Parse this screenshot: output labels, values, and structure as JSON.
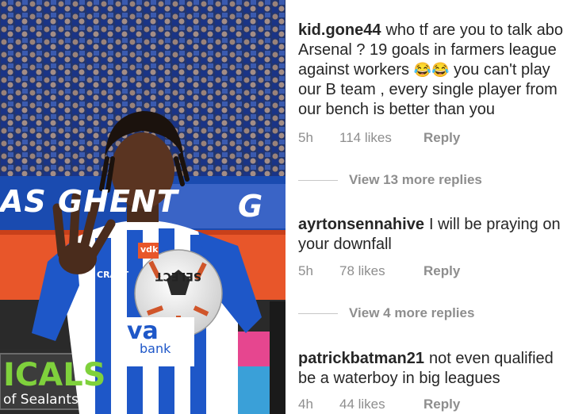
{
  "photo": {
    "banner_left_text": "AS GHENT",
    "banner_right_text": "G",
    "sign_text_main": "ICALS",
    "sign_text_sub": "of Sealants",
    "shirt_sponsor_line1": "va",
    "shirt_sponsor_line2": "bank",
    "shirt_brand": "CRAFT",
    "ball_text": "SELECT",
    "badge_text": "vdk"
  },
  "comments": [
    {
      "username": "kid.gone44",
      "lines": [
        "who tf are you to talk abo",
        "Arsenal ? 19 goals in farmers league",
        "against workers",
        "you can't play",
        "our B team , every single player from",
        "our bench is better than you"
      ],
      "emoji": "😂😂",
      "time": "5h",
      "likes": "114 likes",
      "reply": "Reply"
    },
    {
      "username": "ayrtonsennahive",
      "lines": [
        "I will be praying on",
        "your downfall"
      ],
      "time": "5h",
      "likes": "78 likes",
      "reply": "Reply"
    },
    {
      "username": "patrickbatman21",
      "lines": [
        "not even qualified",
        "be a waterboy in big leagues"
      ],
      "time": "4h",
      "likes": "44 likes",
      "reply": "Reply"
    }
  ],
  "view_more": [
    "View 13 more replies",
    "View 4 more replies"
  ]
}
